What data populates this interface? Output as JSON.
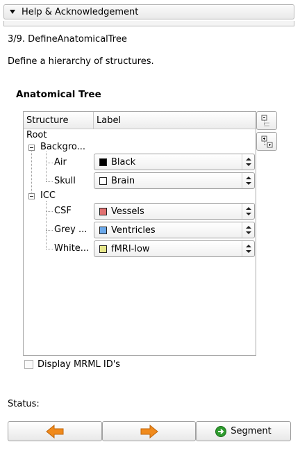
{
  "collapsible": {
    "title": "Help & Acknowledgement"
  },
  "step": {
    "title": "3/9. DefineAnatomicalTree",
    "description": "Define a hierarchy of structures."
  },
  "group": {
    "title": "Anatomical Tree"
  },
  "tree": {
    "headers": {
      "structure": "Structure",
      "label": "Label"
    },
    "root": "Root",
    "nodes": [
      {
        "name": "Backgro...",
        "children": [
          {
            "name": "Air",
            "label": "Black",
            "color": "#000000"
          },
          {
            "name": "Skull",
            "label": "Brain",
            "color": "#ffffff"
          }
        ]
      },
      {
        "name": "ICC",
        "children": [
          {
            "name": "CSF",
            "label": "Vessels",
            "color": "#e07070"
          },
          {
            "name": "Grey ...",
            "label": "Ventricles",
            "color": "#6aa8ea"
          },
          {
            "name": "White...",
            "label": "fMRI-low",
            "color": "#e6e68a"
          }
        ]
      }
    ]
  },
  "side_buttons": {
    "collapse": "collapse-all-icon",
    "expand": "expand-all-icon"
  },
  "checkbox": {
    "label": "Display MRML ID's",
    "checked": false
  },
  "status": {
    "label": "Status:"
  },
  "nav": {
    "back_icon": "arrow-left-icon",
    "next_icon": "arrow-right-icon",
    "segment_label": "Segment",
    "arrow_color": "#f08a1c"
  }
}
